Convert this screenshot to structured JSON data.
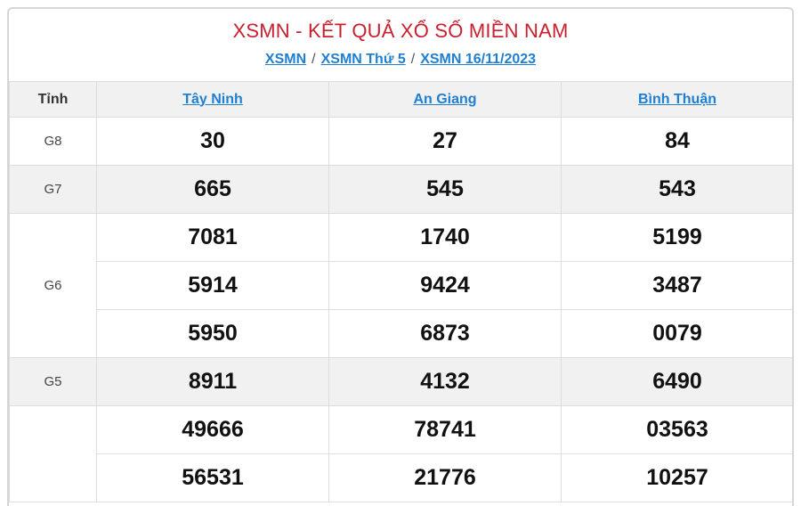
{
  "header": {
    "title": "XSMN - KẾT QUẢ XỔ SỐ MIỀN NAM",
    "breadcrumbs": [
      "XSMN",
      "XSMN Thứ 5",
      "XSMN 16/11/2023"
    ],
    "separator": "/"
  },
  "table": {
    "corner_label": "Tỉnh",
    "provinces": [
      "Tây Ninh",
      "An Giang",
      "Bình Thuận"
    ],
    "prizes": {
      "g8": {
        "label": "G8",
        "values": [
          "30",
          "27",
          "84"
        ]
      },
      "g7": {
        "label": "G7",
        "values": [
          "665",
          "545",
          "543"
        ]
      },
      "g6": {
        "label": "G6",
        "rows": [
          [
            "7081",
            "1740",
            "5199"
          ],
          [
            "5914",
            "9424",
            "3487"
          ],
          [
            "5950",
            "6873",
            "0079"
          ]
        ]
      },
      "g5": {
        "label": "G5",
        "values": [
          "8911",
          "4132",
          "6490"
        ]
      },
      "g4": {
        "rows": [
          [
            "49666",
            "78741",
            "03563"
          ],
          [
            "56531",
            "21776",
            "10257"
          ]
        ]
      }
    }
  },
  "colors": {
    "title": "#c8202f",
    "link": "#1f7fd2",
    "alt_row": "#f1f1f1"
  }
}
